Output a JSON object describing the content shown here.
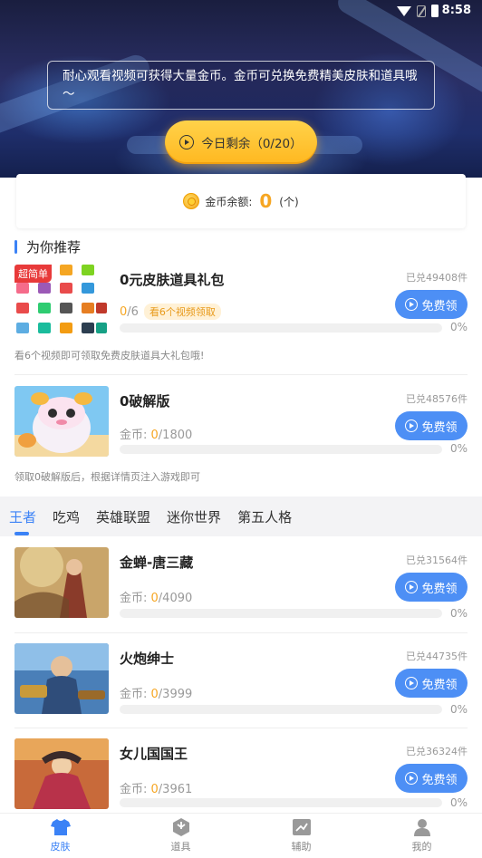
{
  "status_bar": {
    "time": "8:58"
  },
  "hero": {
    "notice": "耐心观看视频可获得大量金币。金币可兑换免费精美皮肤和道具哦～",
    "today_button": "今日剩余（0/20）"
  },
  "balance": {
    "label": "金币余额:",
    "value": "0",
    "unit": "(个)"
  },
  "recommend": {
    "title": "为你推荐",
    "items": [
      {
        "badge": "超简单",
        "title": "0元皮肤道具礼包",
        "redeemed": "已兑49408件",
        "button": "免费领",
        "progress_prefix": "0",
        "progress_total": "/6",
        "tag": "看6个视频领取",
        "percent": "0%",
        "progress": 0,
        "desc": "看6个视频即可领取免费皮肤道具大礼包哦!"
      },
      {
        "title": "0破解版",
        "redeemed": "已兑48576件",
        "button": "免费领",
        "price_label": "金币: ",
        "price_current": "0",
        "price_total": "/1800",
        "percent": "0%",
        "progress": 0,
        "desc": "领取0破解版后，根据详情页注入游戏即可"
      }
    ]
  },
  "tabs": [
    "王者",
    "吃鸡",
    "英雄联盟",
    "迷你世界",
    "第五人格"
  ],
  "skins": [
    {
      "title": "金蝉-唐三藏",
      "redeemed": "已兑31564件",
      "button": "免费领",
      "price_label": "金币: ",
      "price_current": "0",
      "price_total": "/4090",
      "percent": "0%",
      "progress": 0
    },
    {
      "title": "火炮绅士",
      "redeemed": "已兑44735件",
      "button": "免费领",
      "price_label": "金币: ",
      "price_current": "0",
      "price_total": "/3999",
      "percent": "0%",
      "progress": 0
    },
    {
      "title": "女儿国国王",
      "redeemed": "已兑36324件",
      "button": "免费领",
      "price_label": "金币: ",
      "price_current": "0",
      "price_total": "/3961",
      "percent": "0%",
      "progress": 0
    }
  ],
  "bottom_nav": [
    {
      "label": "皮肤",
      "icon": "shirt-icon",
      "active": true
    },
    {
      "label": "道具",
      "icon": "cube-icon",
      "active": false
    },
    {
      "label": "辅助",
      "icon": "tool-icon",
      "active": false
    },
    {
      "label": "我的",
      "icon": "user-icon",
      "active": false
    }
  ],
  "colors": {
    "accent": "#3b82f6",
    "button": "#4d8ff5",
    "gold": "#f6a623",
    "badge": "#e83a3a"
  }
}
